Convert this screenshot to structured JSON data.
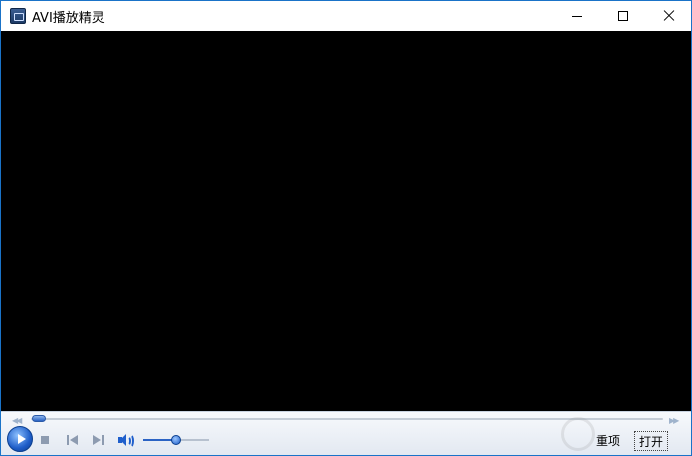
{
  "window": {
    "title": "AVI播放精灵",
    "icon": "app-icon",
    "controls": {
      "minimize_icon": "minimize-icon",
      "maximize_icon": "maximize-icon",
      "close_icon": "close-icon"
    }
  },
  "player": {
    "seek_progress": 0.0,
    "volume_level": 0.5,
    "icons": {
      "play": "play-icon",
      "stop": "stop-icon",
      "previous": "previous-icon",
      "next": "next-icon",
      "volume": "volume-icon",
      "seek_back": "rewind-icon",
      "seek_forward": "fast-forward-icon"
    },
    "buttons": {
      "repeat_label": "重项",
      "open_label": "打开"
    }
  },
  "colors": {
    "accent": "#1e5dc8",
    "video_bg": "#000000",
    "window_border": "#1a73c8"
  }
}
